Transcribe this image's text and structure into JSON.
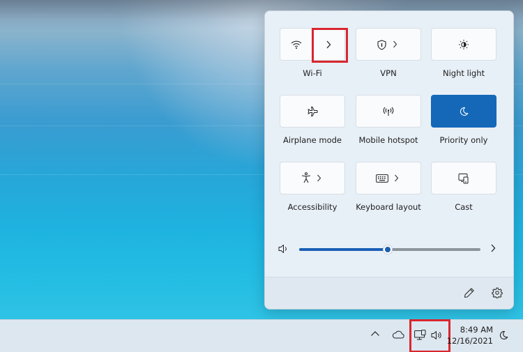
{
  "quick_settings": {
    "tiles": [
      {
        "id": "wifi",
        "label": "Wi-Fi",
        "icon": "wifi-icon",
        "expand_icon": "chevron-right-icon",
        "active": false
      },
      {
        "id": "vpn",
        "label": "VPN",
        "icon": "shield-icon",
        "expand_icon": "chevron-right-icon",
        "active": false
      },
      {
        "id": "night-light",
        "label": "Night light",
        "icon": "brightness-icon",
        "active": false
      },
      {
        "id": "airplane",
        "label": "Airplane mode",
        "icon": "airplane-icon",
        "active": false
      },
      {
        "id": "hotspot",
        "label": "Mobile hotspot",
        "icon": "hotspot-icon",
        "active": false
      },
      {
        "id": "priority",
        "label": "Priority only",
        "icon": "moon-icon",
        "active": true
      },
      {
        "id": "accessibility",
        "label": "Accessibility",
        "icon": "accessibility-icon",
        "expand_icon": "chevron-right-icon",
        "active": false
      },
      {
        "id": "keyboard",
        "label": "Keyboard layout",
        "icon": "keyboard-icon",
        "expand_icon": "chevron-right-icon",
        "active": false
      },
      {
        "id": "cast",
        "label": "Cast",
        "icon": "cast-icon",
        "active": false
      }
    ],
    "volume": {
      "level": 0.49,
      "icon": "speaker-icon",
      "more_icon": "chevron-right-icon"
    },
    "footer": {
      "edit_icon": "pencil-icon",
      "settings_icon": "gear-icon"
    },
    "accent_color": "#1568b8",
    "highlight_color": "#d9262e"
  },
  "taskbar": {
    "tray_icons": [
      "chevron-up-icon",
      "cloud-icon",
      "network-icon",
      "speaker-icon"
    ],
    "clock": {
      "time": "8:49 AM",
      "date": "12/16/2021"
    },
    "focus_icon": "moon-icon"
  }
}
